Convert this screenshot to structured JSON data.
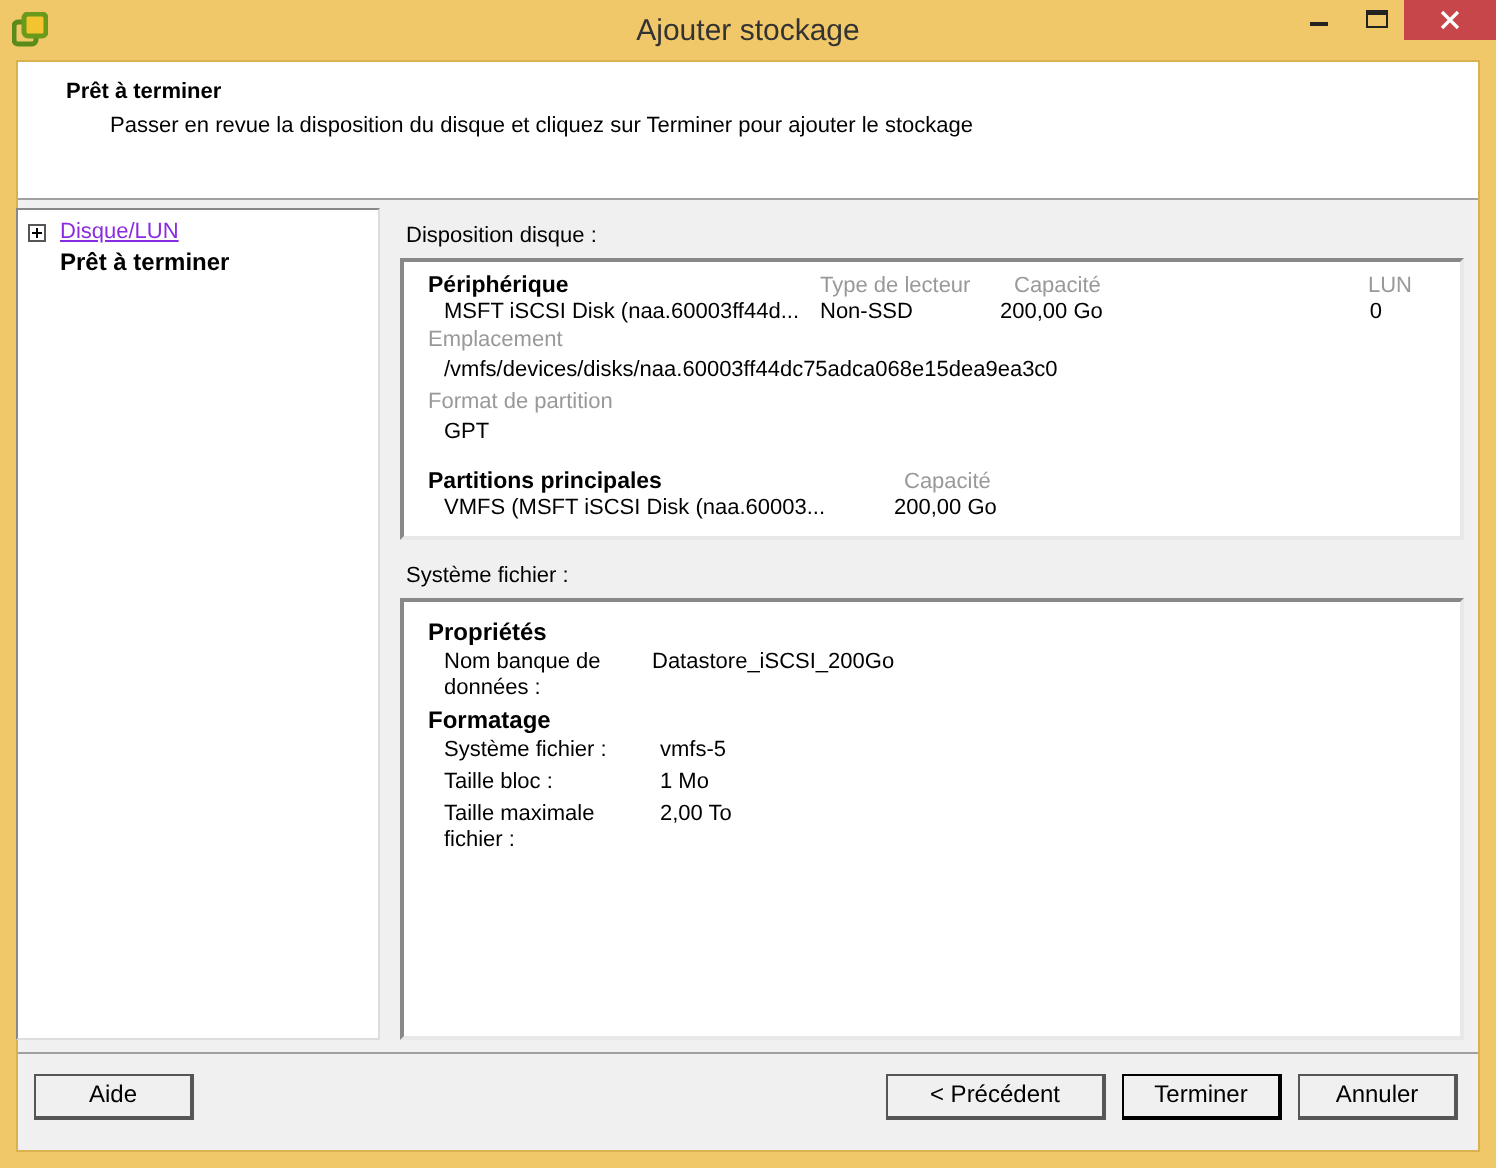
{
  "window": {
    "title": "Ajouter stockage"
  },
  "header": {
    "title": "Prêt à terminer",
    "subtitle": "Passer en revue la disposition du disque et cliquez sur Terminer pour ajouter le stockage"
  },
  "steps": [
    {
      "label": "Disque/LUN",
      "kind": "link",
      "expanded": false,
      "selected": false
    },
    {
      "label": "Prêt à terminer",
      "kind": "current",
      "selected": true
    }
  ],
  "disk_layout": {
    "label": "Disposition disque :",
    "device": {
      "heading": "Périphérique",
      "columns": [
        "Type de lecteur",
        "Capacité",
        "LUN"
      ],
      "name": "MSFT iSCSI Disk (naa.60003ff44d...",
      "drive_type": "Non-SSD",
      "capacity": "200,00 Go",
      "lun": "0"
    },
    "location": {
      "label": "Emplacement",
      "value": "/vmfs/devices/disks/naa.60003ff44dc75adca068e15dea9ea3c0"
    },
    "partition_format": {
      "label": "Format de partition",
      "value": "GPT"
    },
    "partitions": {
      "heading": "Partitions principales",
      "column": "Capacité",
      "name": "VMFS (MSFT iSCSI Disk (naa.60003...",
      "capacity": "200,00 Go"
    }
  },
  "file_system": {
    "label": "Système fichier :",
    "groups": [
      {
        "heading": "Propriétés",
        "rows": [
          {
            "label": "Nom banque de données :",
            "value": "Datastore_iSCSI_200Go"
          }
        ]
      },
      {
        "heading": "Formatage",
        "rows": [
          {
            "label": "Système fichier :",
            "value": "vmfs-5"
          },
          {
            "label": "Taille bloc :",
            "value": "1 Mo"
          },
          {
            "label": "Taille maximale fichier :",
            "value": "2,00 To"
          }
        ]
      }
    ]
  },
  "buttons": [
    {
      "label": "Aide",
      "kind": "help"
    },
    {
      "label": "< Précédent",
      "kind": "nav"
    },
    {
      "label": "Terminer",
      "kind": "default"
    },
    {
      "label": "Annuler",
      "kind": "nav"
    }
  ]
}
